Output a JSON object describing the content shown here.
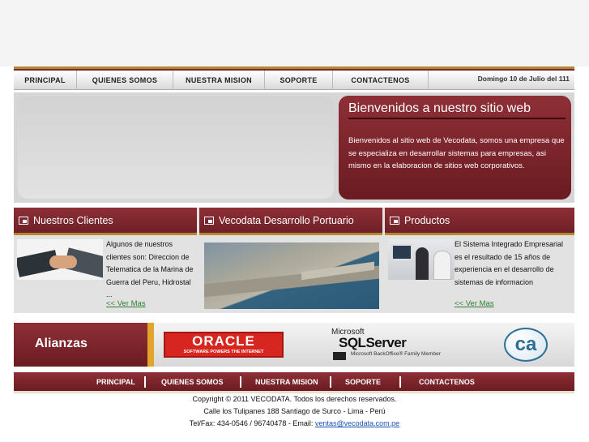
{
  "nav": {
    "items": [
      "PRINCIPAL",
      "QUIENES SOMOS",
      "NUESTRA MISION",
      "SOPORTE",
      "CONTACTENOS"
    ],
    "date": "Domingo 10 de Julio del 111"
  },
  "hero": {
    "title": "Bienvenidos a nuestro sitio web",
    "text": "Bienvenidos al sitio web de Vecodata, somos una empresa que se especializa en desarrollar sistemas para empresas, asi mismo en la elaboracion de sitios web corporativos."
  },
  "sections": {
    "clients": {
      "title": "Nuestros Clientes",
      "text": "Algunos de nuestros clientes son: Direccion de Telematica de la Marina de Guerra del Peru, Hidrostal ...",
      "link": "<< Ver Mas"
    },
    "port": {
      "title": "Vecodata Desarrollo Portuario"
    },
    "products": {
      "title": "Productos",
      "text": "El Sistema Integrado Empresarial es el resultado de 15 años de experiencia en el desarrollo de sistemas de informacion",
      "link": "<< Ver Mas"
    }
  },
  "alianzas": {
    "label": "Alianzas",
    "oracle_name": "ORACLE",
    "oracle_tagline": "SOFTWARE POWERS THE INTERNET",
    "sql_vendor": "Microsoft",
    "sql_name": "SQLServer",
    "sql_sub": "Microsoft BackOffice® Family Member",
    "ca_logo": "ca"
  },
  "footer": {
    "nav": [
      "PRINCIPAL",
      "QUIENES SOMOS",
      "NUESTRA MISION",
      "SOPORTE",
      "CONTACTENOS"
    ],
    "copyright": "Copyright © 2011 VECODATA. Todos los derechos reservados.",
    "address": "Calle los Tulipanes 188 Santiago de Surco - Lima - Perú",
    "contact_prefix": "Tel/Fax: 434-0546 / 96740478 - Email:",
    "email": "ventas@vecodata.com.pe"
  },
  "colors": {
    "maroon": "#7a2a2e",
    "gold": "#b5882f",
    "link_green": "#2e7d2e"
  }
}
